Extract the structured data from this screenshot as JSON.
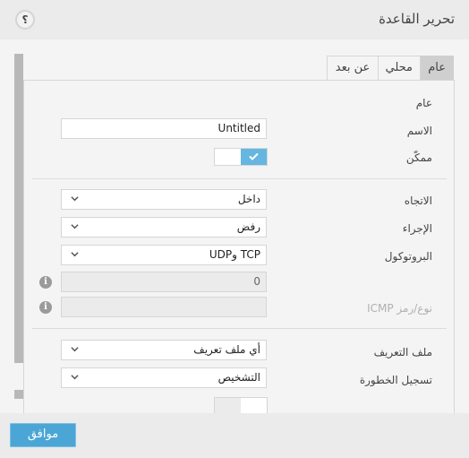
{
  "header": {
    "title": "تحرير القاعدة",
    "help_label": "؟"
  },
  "tabs": [
    {
      "label": "عام",
      "active": true
    },
    {
      "label": "محلي",
      "active": false
    },
    {
      "label": "عن بعد",
      "active": false
    }
  ],
  "general": {
    "section_label": "عام",
    "name": {
      "label": "الاسم",
      "value": "Untitled"
    },
    "enabled": {
      "label": "ممكّن",
      "checked": true
    }
  },
  "rule": {
    "direction": {
      "label": "الاتجاه",
      "value": "داخل"
    },
    "action": {
      "label": "الإجراء",
      "value": "رفض"
    },
    "protocol": {
      "label": "البروتوكول",
      "value": "TCP وUDP"
    },
    "protocol_number": {
      "value": "0"
    },
    "icmp": {
      "label": "نوع/رمز ICMP",
      "value": ""
    }
  },
  "advanced": {
    "profile": {
      "label": "ملف التعريف",
      "value": "أي ملف تعريف"
    },
    "log_severity": {
      "label": "تسجيل الخطورة",
      "value": "التشخيص"
    }
  },
  "footer": {
    "ok_label": "موافق"
  },
  "colors": {
    "accent": "#4ba6d6",
    "toggle_on": "#65b6e0",
    "active_tab": "#cfcfcf"
  }
}
